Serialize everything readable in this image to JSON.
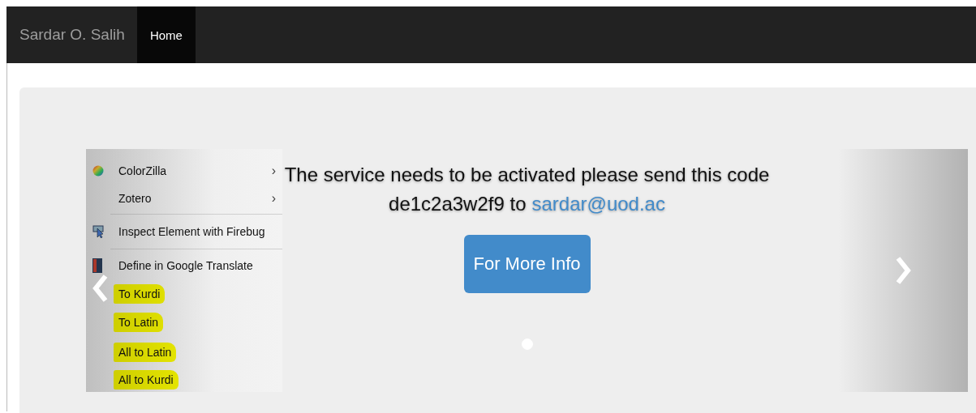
{
  "navbar": {
    "brand": "Sardar O. Salih",
    "items": [
      {
        "label": "Home",
        "selected": true
      }
    ]
  },
  "carousel": {
    "slides": [
      {
        "menu": [
          {
            "kind": "picker",
            "label": "ColorZilla",
            "arrow": "›",
            "highlighted": false,
            "separator_after": false
          },
          {
            "kind": "plain",
            "label": "Zotero",
            "arrow": "›",
            "highlighted": false,
            "separator_after": true
          },
          {
            "kind": "inspect",
            "label": "Inspect Element with Firebug",
            "highlighted": false,
            "separator_after": true
          },
          {
            "kind": "dictionary",
            "label": "Define in Google Translate",
            "highlighted": false,
            "separator_after": false
          },
          {
            "kind": "plain",
            "label": "To Kurdi",
            "highlighted": true,
            "separator_after": false
          },
          {
            "kind": "plain",
            "label": "To Latin",
            "highlighted": true,
            "separator_after": false
          },
          {
            "kind": "plain",
            "label": "All to Latin",
            "highlighted": true,
            "separator_after": false
          },
          {
            "kind": "plain",
            "label": "All to Kurdi",
            "highlighted": true,
            "separator_after": false
          }
        ],
        "caption": {
          "line_1": "The service needs to be activated please send this code",
          "line_2_text": "de1c2a3w2f9 to",
          "email": "sardar@uod.ac",
          "button": "For More Info"
        }
      }
    ],
    "indicators": [
      {
        "selected": true
      }
    ]
  }
}
